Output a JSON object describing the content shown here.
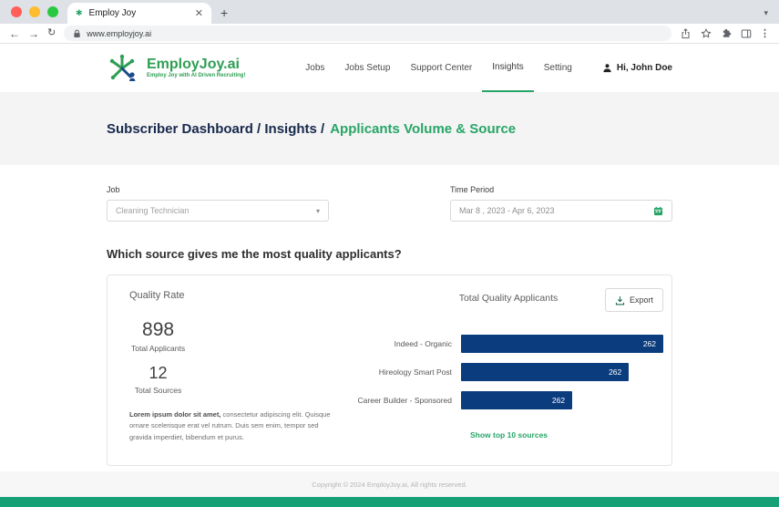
{
  "browser": {
    "tab_title": "Employ Joy",
    "url": "www.employjoy.ai"
  },
  "header": {
    "logo_title": "EmployJoy.ai",
    "logo_tagline": "Employ Joy with AI Driven Recruiting!",
    "nav": [
      {
        "label": "Jobs"
      },
      {
        "label": "Jobs Setup"
      },
      {
        "label": "Support Center"
      },
      {
        "label": "Insights"
      },
      {
        "label": "Setting"
      }
    ],
    "user_greeting": "Hi, John Doe"
  },
  "breadcrumb": {
    "path": "Subscriber Dashboard / Insights /",
    "current": "Applicants Volume & Source"
  },
  "filters": {
    "job_label": "Job",
    "job_value": "Cleaning Technician",
    "period_label": "Time Period",
    "period_value": "Mar 8 , 2023 - Apr 6, 2023"
  },
  "question": "Which source gives me the most quality applicants?",
  "card": {
    "quality_rate_title": "Quality Rate",
    "total_applicants_value": "898",
    "total_applicants_label": "Total Applicants",
    "total_sources_value": "12",
    "total_sources_label": "Total Sources",
    "description_lead": "Lorem ipsum dolor sit amet,",
    "description_rest": " consectetur adipiscing elit. Quisque ornare scelerisque erat vel rutrum. Duis sem enim, tempor sed gravida imperdiet, bibendum et purus.",
    "chart_title": "Total Quality Applicants",
    "export_label": "Export",
    "show_link": "Show top 10 sources"
  },
  "chart_data": {
    "type": "bar",
    "orientation": "horizontal",
    "title": "Total Quality Applicants",
    "categories": [
      "Indeed - Organic",
      "Hireology Smart Post",
      "Career Builder - Sponsored"
    ],
    "values": [
      262,
      262,
      262
    ],
    "bar_relative_widths": [
      1.0,
      0.83,
      0.55
    ],
    "bar_color": "#0b3c7e",
    "legend": false,
    "grid": false
  },
  "footer": "Copyright © 2024 EmployJoy.ai, All rights reserved.",
  "colors": {
    "accent_green": "#27a567",
    "navy_bar": "#0b3c7e",
    "breadcrumb_navy": "#17294d",
    "bottom_strip": "#16a075"
  }
}
